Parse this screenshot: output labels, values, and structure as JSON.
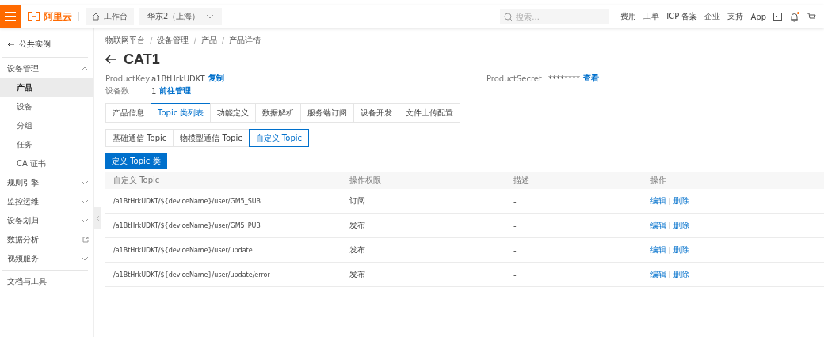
{
  "topbar": {
    "logo": "阿里云",
    "workbench": "工作台",
    "region": "华东2（上海）",
    "search": {
      "placeholder": "搜索..."
    },
    "links": [
      "费用",
      "工单",
      "ICP 备案",
      "企业",
      "支持",
      "App"
    ],
    "notification_dot": true
  },
  "sidebar": {
    "back": "公共实例",
    "groups": [
      {
        "label": "设备管理",
        "expanded": true,
        "children": [
          {
            "label": "产品",
            "selected": true
          },
          {
            "label": "设备",
            "selected": false
          },
          {
            "label": "分组",
            "selected": false
          },
          {
            "label": "任务",
            "selected": false
          },
          {
            "label": "CA 证书",
            "selected": false
          }
        ]
      },
      {
        "label": "规则引擎",
        "expanded": false,
        "kind": "group"
      },
      {
        "label": "监控运维",
        "expanded": false,
        "kind": "group"
      },
      {
        "label": "设备划归",
        "expanded": false,
        "kind": "group"
      },
      {
        "label": "数据分析",
        "kind": "external"
      },
      {
        "label": "视频服务",
        "expanded": false,
        "kind": "group"
      }
    ],
    "footer": "文档与工具"
  },
  "breadcrumb": {
    "items": [
      "物联网平台",
      "设备管理",
      "产品",
      "产品详情"
    ],
    "separator": "/"
  },
  "title": "CAT1",
  "info": [
    {
      "label": "ProductKey",
      "value": "a1BtHrkUDKT",
      "link": "复制"
    },
    {
      "label": "ProductSecret",
      "value": "********",
      "link": "查看"
    },
    {
      "label": "设备数",
      "value": "1",
      "link": "前往管理"
    }
  ],
  "tabs": [
    {
      "label": "产品信息",
      "selected": false
    },
    {
      "label": "Topic 类列表",
      "selected": true
    },
    {
      "label": "功能定义",
      "selected": false
    },
    {
      "label": "数据解析",
      "selected": false
    },
    {
      "label": "服务端订阅",
      "selected": false
    },
    {
      "label": "设备开发",
      "selected": false
    },
    {
      "label": "文件上传配置",
      "selected": false
    }
  ],
  "subtabs": [
    {
      "label": "基础通信 Topic",
      "selected": false
    },
    {
      "label": "物模型通信 Topic",
      "selected": false
    },
    {
      "label": "自定义 Topic",
      "selected": true
    }
  ],
  "primary_button": "定义 Topic 类",
  "table": {
    "columns": [
      "自定义 Topic",
      "操作权限",
      "描述",
      "操作"
    ],
    "rows": [
      {
        "topic": "/a1BtHrkUDKT/${deviceName}/user/GM5_SUB",
        "permission": "订阅",
        "description": "-",
        "actions": [
          "编辑",
          "删除"
        ]
      },
      {
        "topic": "/a1BtHrkUDKT/${deviceName}/user/GM5_PUB",
        "permission": "发布",
        "description": "-",
        "actions": [
          "编辑",
          "删除"
        ]
      },
      {
        "topic": "/a1BtHrkUDKT/${deviceName}/user/update",
        "permission": "发布",
        "description": "-",
        "actions": [
          "编辑",
          "删除"
        ]
      },
      {
        "topic": "/a1BtHrkUDKT/${deviceName}/user/update/error",
        "permission": "发布",
        "description": "-",
        "actions": [
          "编辑",
          "删除"
        ]
      }
    ]
  }
}
